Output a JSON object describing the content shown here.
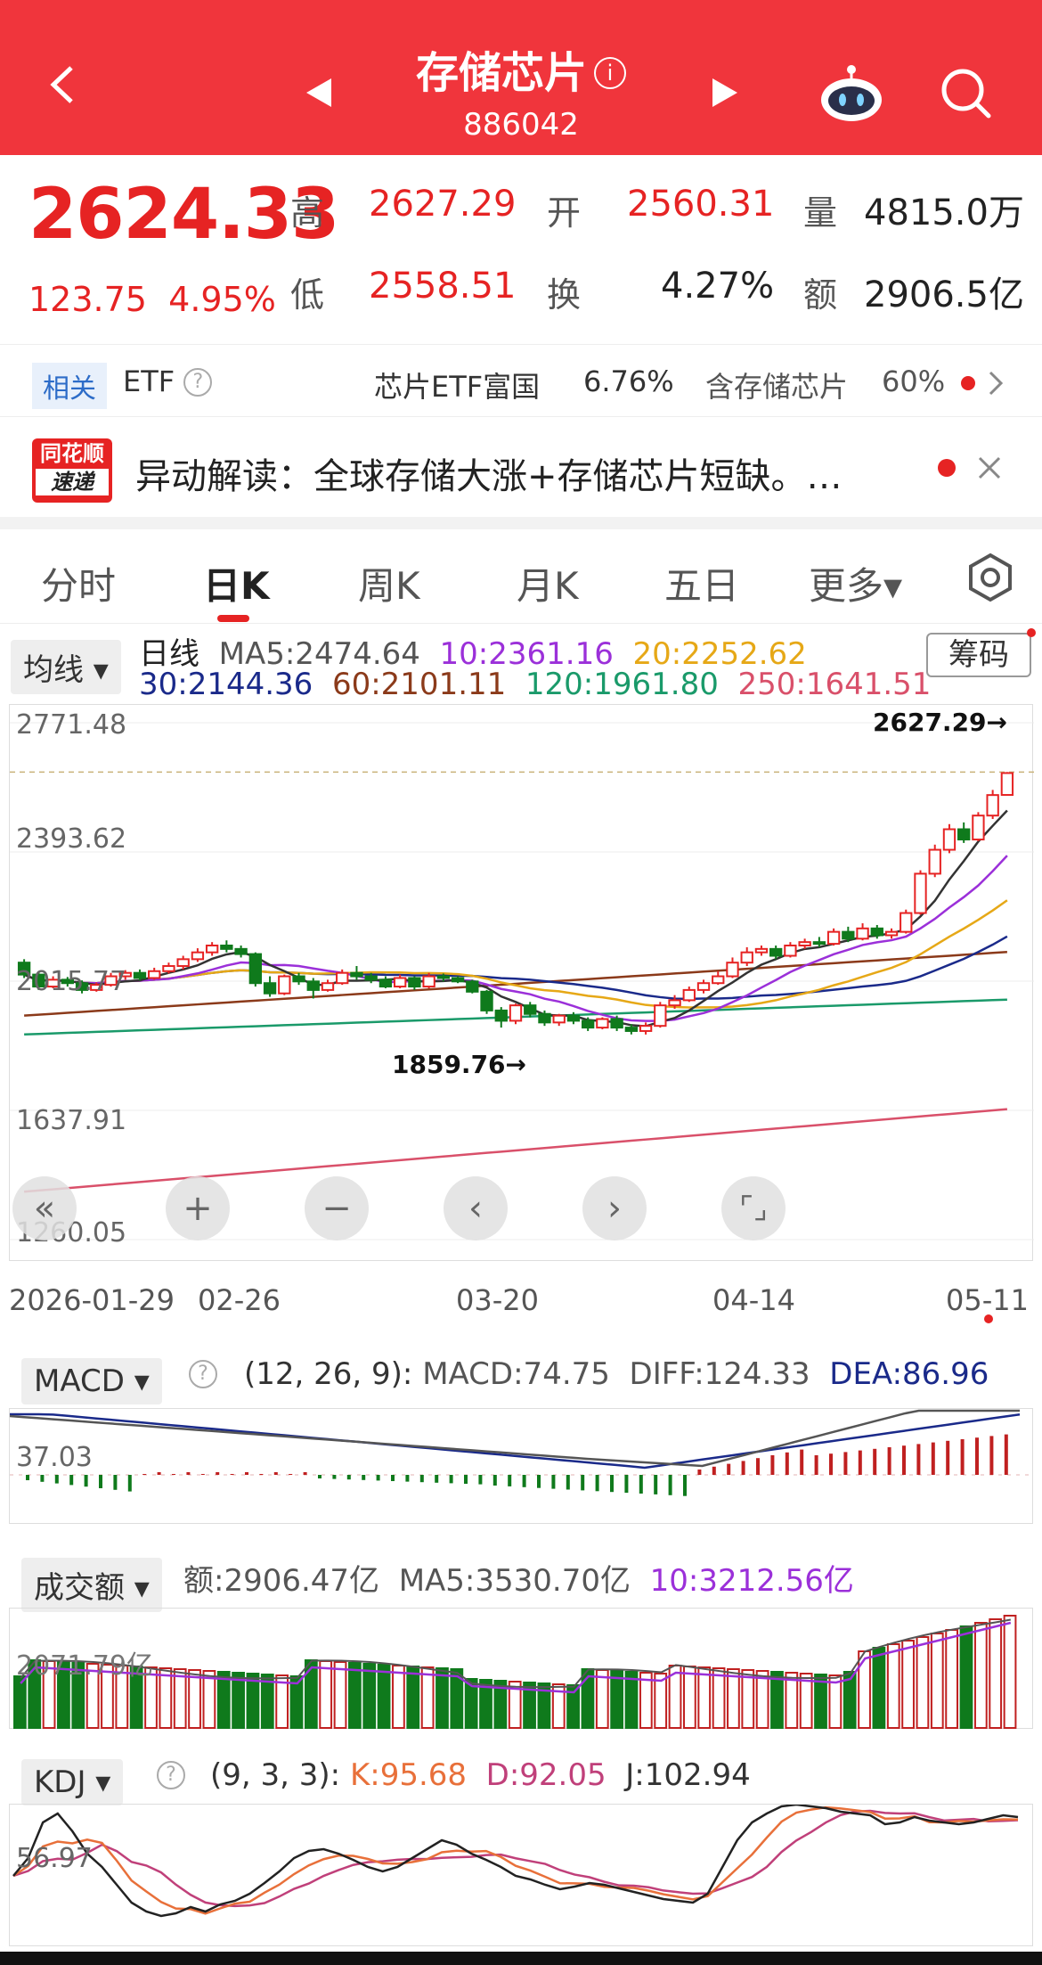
{
  "header": {
    "title": "存储芯片",
    "code": "886042"
  },
  "quote": {
    "price": "2624.33",
    "change": "123.75",
    "change_pct": "4.95%",
    "high_label": "高",
    "high": "2627.29",
    "low_label": "低",
    "low": "2558.51",
    "open_label": "开",
    "open": "2560.31",
    "turnover_label": "换",
    "turnover": "4.27%",
    "volume_label": "量",
    "volume": "4815.0万",
    "amount_label": "额",
    "amount": "2906.5亿"
  },
  "etf": {
    "tag": "相关",
    "label": "ETF",
    "fund": "芯片ETF富国",
    "fund_pct": "6.76%",
    "holding": "含存储芯片",
    "holding_pct": "60%"
  },
  "news": {
    "logo_top": "同花顺",
    "logo_bottom": "速递",
    "text": "异动解读：全球存储大涨+存储芯片短缺。…"
  },
  "tabs": [
    "分时",
    "日K",
    "周K",
    "月K",
    "五日",
    "更多▾"
  ],
  "kline": {
    "ma_button": "均线 ▾",
    "period": "日线",
    "ma5": "MA5:2474.64",
    "ma10": "10:2361.16",
    "ma20": "20:2252.62",
    "ma30": "30:2144.36",
    "ma60": "60:2101.11",
    "ma120": "120:1961.80",
    "ma250": "250:1641.51",
    "chip_button": "筹码",
    "y_labels": [
      "2771.48",
      "2393.62",
      "2015.77",
      "1637.91",
      "1260.05"
    ],
    "high_mark": "2627.29→",
    "low_mark": "1859.76→",
    "x_labels": [
      "2026-01-29",
      "02-26",
      "03-20",
      "04-14",
      "05-11"
    ]
  },
  "macd": {
    "button": "MACD ▾",
    "params": "(12, 26, 9):",
    "macd": "MACD:74.75",
    "diff": "DIFF:124.33",
    "dea": "DEA:86.96",
    "y_label": "37.03"
  },
  "amount": {
    "button": "成交额 ▾",
    "value": "额:2906.47亿",
    "ma5": "MA5:3530.70亿",
    "ma10": "10:3212.56亿",
    "y_label": "2071.79亿"
  },
  "kdj": {
    "button": "KDJ ▾",
    "params": "(9, 3, 3):",
    "k": "K:95.68",
    "d": "D:92.05",
    "j": "J:102.94",
    "y_label": "56.97"
  },
  "colors": {
    "up": "#e62323",
    "down": "#0f7a1c",
    "ma5": "#333333",
    "ma10": "#9b30d9",
    "ma20": "#e6a817",
    "ma30": "#1a2a8a",
    "ma60": "#8b3a1a",
    "ma120": "#1a9a6a",
    "ma250": "#d9506a"
  },
  "chart_data": {
    "type": "candlestick",
    "title": "存储芯片 日线",
    "ylim": [
      1260.05,
      2771.48
    ],
    "candles": [
      {
        "o": 2070,
        "c": 2035,
        "h": 2080,
        "l": 2025
      },
      {
        "o": 2035,
        "c": 2000,
        "h": 2045,
        "l": 1990
      },
      {
        "o": 2000,
        "c": 2020,
        "h": 2030,
        "l": 1995
      },
      {
        "o": 2020,
        "c": 2010,
        "h": 2028,
        "l": 2000
      },
      {
        "o": 2010,
        "c": 1990,
        "h": 2018,
        "l": 1980
      },
      {
        "o": 1990,
        "c": 2005,
        "h": 2012,
        "l": 1985
      },
      {
        "o": 2005,
        "c": 2030,
        "h": 2040,
        "l": 2000
      },
      {
        "o": 2030,
        "c": 2040,
        "h": 2048,
        "l": 2020
      },
      {
        "o": 2040,
        "c": 2025,
        "h": 2050,
        "l": 2018
      },
      {
        "o": 2025,
        "c": 2045,
        "h": 2055,
        "l": 2020
      },
      {
        "o": 2045,
        "c": 2060,
        "h": 2070,
        "l": 2038
      },
      {
        "o": 2060,
        "c": 2080,
        "h": 2090,
        "l": 2050
      },
      {
        "o": 2080,
        "c": 2100,
        "h": 2112,
        "l": 2072
      },
      {
        "o": 2100,
        "c": 2120,
        "h": 2130,
        "l": 2090
      },
      {
        "o": 2120,
        "c": 2110,
        "h": 2135,
        "l": 2100
      },
      {
        "o": 2110,
        "c": 2095,
        "h": 2120,
        "l": 2085
      },
      {
        "o": 2095,
        "c": 2010,
        "h": 2100,
        "l": 2000
      },
      {
        "o": 2010,
        "c": 1980,
        "h": 2030,
        "l": 1970
      },
      {
        "o": 1980,
        "c": 2030,
        "h": 2035,
        "l": 1975
      },
      {
        "o": 2030,
        "c": 2015,
        "h": 2040,
        "l": 2005
      },
      {
        "o": 2015,
        "c": 1990,
        "h": 2025,
        "l": 1965
      },
      {
        "o": 1990,
        "c": 2010,
        "h": 2020,
        "l": 1985
      },
      {
        "o": 2010,
        "c": 2040,
        "h": 2050,
        "l": 2005
      },
      {
        "o": 2040,
        "c": 2030,
        "h": 2060,
        "l": 2020
      },
      {
        "o": 2030,
        "c": 2020,
        "h": 2040,
        "l": 2010
      },
      {
        "o": 2020,
        "c": 2000,
        "h": 2030,
        "l": 1995
      },
      {
        "o": 2000,
        "c": 2025,
        "h": 2035,
        "l": 1995
      },
      {
        "o": 2025,
        "c": 2000,
        "h": 2030,
        "l": 1990
      },
      {
        "o": 2000,
        "c": 2030,
        "h": 2040,
        "l": 1995
      },
      {
        "o": 2030,
        "c": 2025,
        "h": 2038,
        "l": 2015
      },
      {
        "o": 2025,
        "c": 2015,
        "h": 2030,
        "l": 2010
      },
      {
        "o": 2015,
        "c": 1985,
        "h": 2020,
        "l": 1980
      },
      {
        "o": 1985,
        "c": 1930,
        "h": 1990,
        "l": 1920
      },
      {
        "o": 1930,
        "c": 1900,
        "h": 1940,
        "l": 1880
      },
      {
        "o": 1900,
        "c": 1945,
        "h": 1950,
        "l": 1890
      },
      {
        "o": 1945,
        "c": 1920,
        "h": 1955,
        "l": 1910
      },
      {
        "o": 1920,
        "c": 1895,
        "h": 1930,
        "l": 1885
      },
      {
        "o": 1895,
        "c": 1915,
        "h": 1920,
        "l": 1885
      },
      {
        "o": 1915,
        "c": 1900,
        "h": 1925,
        "l": 1890
      },
      {
        "o": 1900,
        "c": 1880,
        "h": 1910,
        "l": 1870
      },
      {
        "o": 1880,
        "c": 1905,
        "h": 1910,
        "l": 1875
      },
      {
        "o": 1905,
        "c": 1880,
        "h": 1915,
        "l": 1870
      },
      {
        "o": 1880,
        "c": 1870,
        "h": 1890,
        "l": 1860
      },
      {
        "o": 1870,
        "c": 1885,
        "h": 1895,
        "l": 1859.76
      },
      {
        "o": 1885,
        "c": 1945,
        "h": 1955,
        "l": 1880
      },
      {
        "o": 1945,
        "c": 1960,
        "h": 1975,
        "l": 1935
      },
      {
        "o": 1960,
        "c": 1990,
        "h": 2000,
        "l": 1955
      },
      {
        "o": 1990,
        "c": 2010,
        "h": 2020,
        "l": 1980
      },
      {
        "o": 2010,
        "c": 2030,
        "h": 2045,
        "l": 2005
      },
      {
        "o": 2030,
        "c": 2070,
        "h": 2085,
        "l": 2025
      },
      {
        "o": 2070,
        "c": 2100,
        "h": 2115,
        "l": 2060
      },
      {
        "o": 2100,
        "c": 2110,
        "h": 2120,
        "l": 2090
      },
      {
        "o": 2110,
        "c": 2090,
        "h": 2120,
        "l": 2080
      },
      {
        "o": 2090,
        "c": 2120,
        "h": 2130,
        "l": 2085
      },
      {
        "o": 2120,
        "c": 2130,
        "h": 2140,
        "l": 2110
      },
      {
        "o": 2130,
        "c": 2125,
        "h": 2145,
        "l": 2115
      },
      {
        "o": 2125,
        "c": 2160,
        "h": 2170,
        "l": 2120
      },
      {
        "o": 2160,
        "c": 2140,
        "h": 2175,
        "l": 2130
      },
      {
        "o": 2140,
        "c": 2170,
        "h": 2185,
        "l": 2135
      },
      {
        "o": 2170,
        "c": 2150,
        "h": 2180,
        "l": 2140
      },
      {
        "o": 2150,
        "c": 2160,
        "h": 2170,
        "l": 2140
      },
      {
        "o": 2160,
        "c": 2215,
        "h": 2225,
        "l": 2155
      },
      {
        "o": 2215,
        "c": 2330,
        "h": 2340,
        "l": 2210
      },
      {
        "o": 2330,
        "c": 2400,
        "h": 2415,
        "l": 2320
      },
      {
        "o": 2400,
        "c": 2460,
        "h": 2475,
        "l": 2390
      },
      {
        "o": 2460,
        "c": 2430,
        "h": 2480,
        "l": 2420
      },
      {
        "o": 2430,
        "c": 2500,
        "h": 2510,
        "l": 2425
      },
      {
        "o": 2500,
        "c": 2560,
        "h": 2575,
        "l": 2490
      },
      {
        "o": 2560.31,
        "c": 2624.33,
        "h": 2627.29,
        "l": 2558.51
      }
    ]
  }
}
